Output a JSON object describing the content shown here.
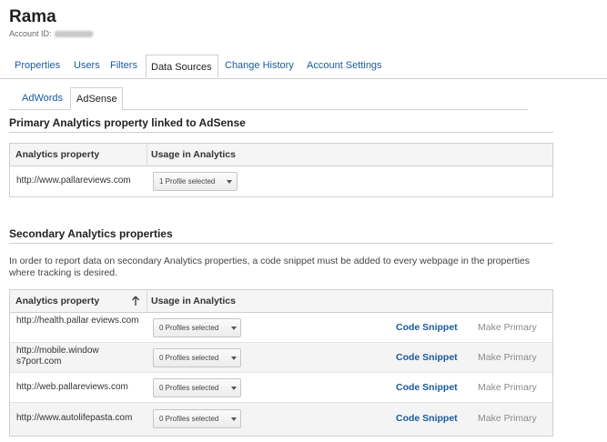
{
  "account": {
    "name": "Rama",
    "id_label": "Account ID:"
  },
  "main_tabs": [
    "Properties",
    "Users",
    "Filters",
    "Data Sources",
    "Change History",
    "Account Settings"
  ],
  "sub_tabs": [
    "AdWords",
    "AdSense"
  ],
  "primary": {
    "title": "Primary Analytics property linked to AdSense",
    "col_property": "Analytics property",
    "col_usage": "Usage in Analytics",
    "row": {
      "url": "http://www.pallareviews.com",
      "usage": "1 Profile selected"
    }
  },
  "secondary": {
    "title": "Secondary Analytics properties",
    "description": "In order to report data on secondary Analytics properties, a code snippet must be added to every webpage in the properties where tracking is desired.",
    "col_property": "Analytics property",
    "col_usage": "Usage in Analytics",
    "code_label": "Code Snippet",
    "primary_label": "Make Primary",
    "rows": [
      {
        "url": "http://health.pallar eviews.com",
        "usage": "0 Profiles selected"
      },
      {
        "url": "http://mobile.window s7port.com",
        "usage": "0 Profiles selected"
      },
      {
        "url": "http://web.pallareviews.com",
        "usage": "0 Profiles selected"
      },
      {
        "url": "http://www.autolifepasta.com",
        "usage": "0 Profiles selected"
      }
    ]
  },
  "colors": {
    "link": "#1a5a9e",
    "border": "#cfcfcf"
  },
  "icons": {
    "sort": "arrow-up-icon",
    "dropdown": "caret-down-icon"
  }
}
